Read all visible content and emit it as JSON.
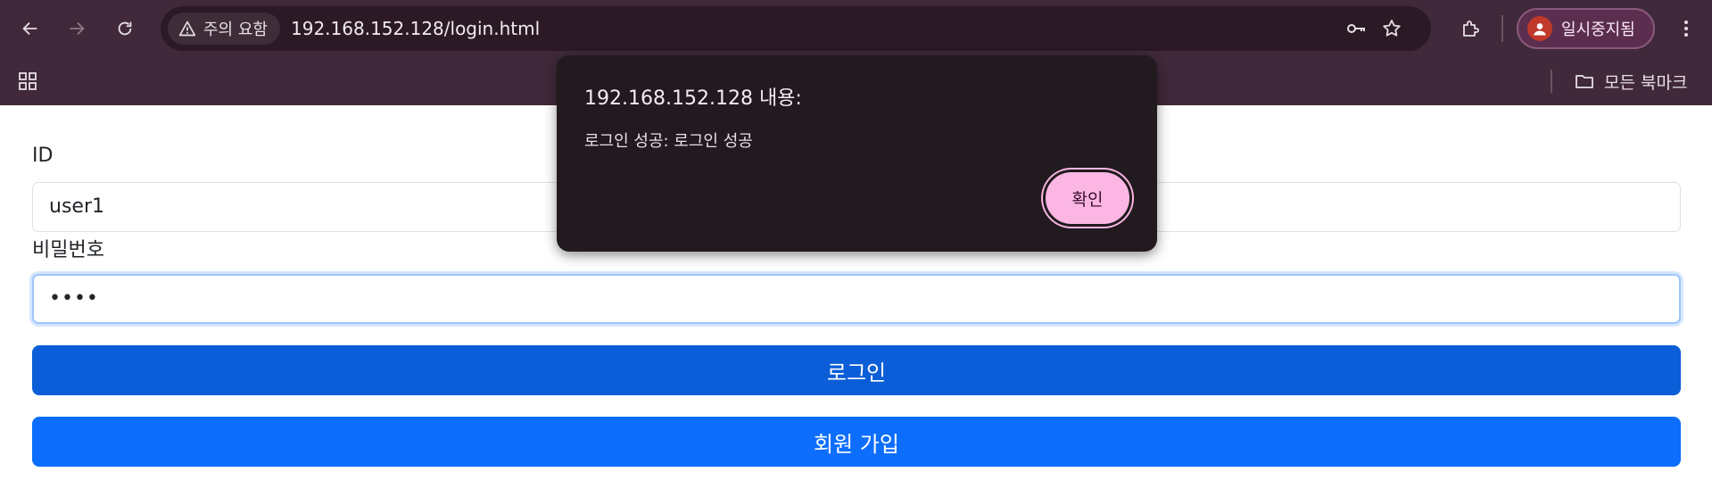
{
  "browser": {
    "security_chip_label": "주의 요함",
    "url": "192.168.152.128/login.html",
    "profile_label": "일시중지됨",
    "all_bookmarks_label": "모든 북마크"
  },
  "form": {
    "id_label": "ID",
    "id_value": "user1",
    "password_label": "비밀번호",
    "password_masked": "••••",
    "login_button": "로그인",
    "signup_button": "회원 가입"
  },
  "dialog": {
    "title": "192.168.152.128 내용:",
    "message": "로그인 성공: 로그인 성공",
    "ok_button": "확인"
  },
  "colors": {
    "chrome_background": "#40293a",
    "primary_button": "#0b5ed7",
    "signup_button": "#0d6efd",
    "dialog_background": "#211a1f",
    "dialog_ok_button": "#fcb6e3"
  },
  "icons": [
    "back-icon",
    "forward-icon",
    "reload-icon",
    "warning-icon",
    "key-icon",
    "star-icon",
    "extensions-icon",
    "profile-icon",
    "more-icon",
    "apps-icon",
    "folder-icon"
  ]
}
